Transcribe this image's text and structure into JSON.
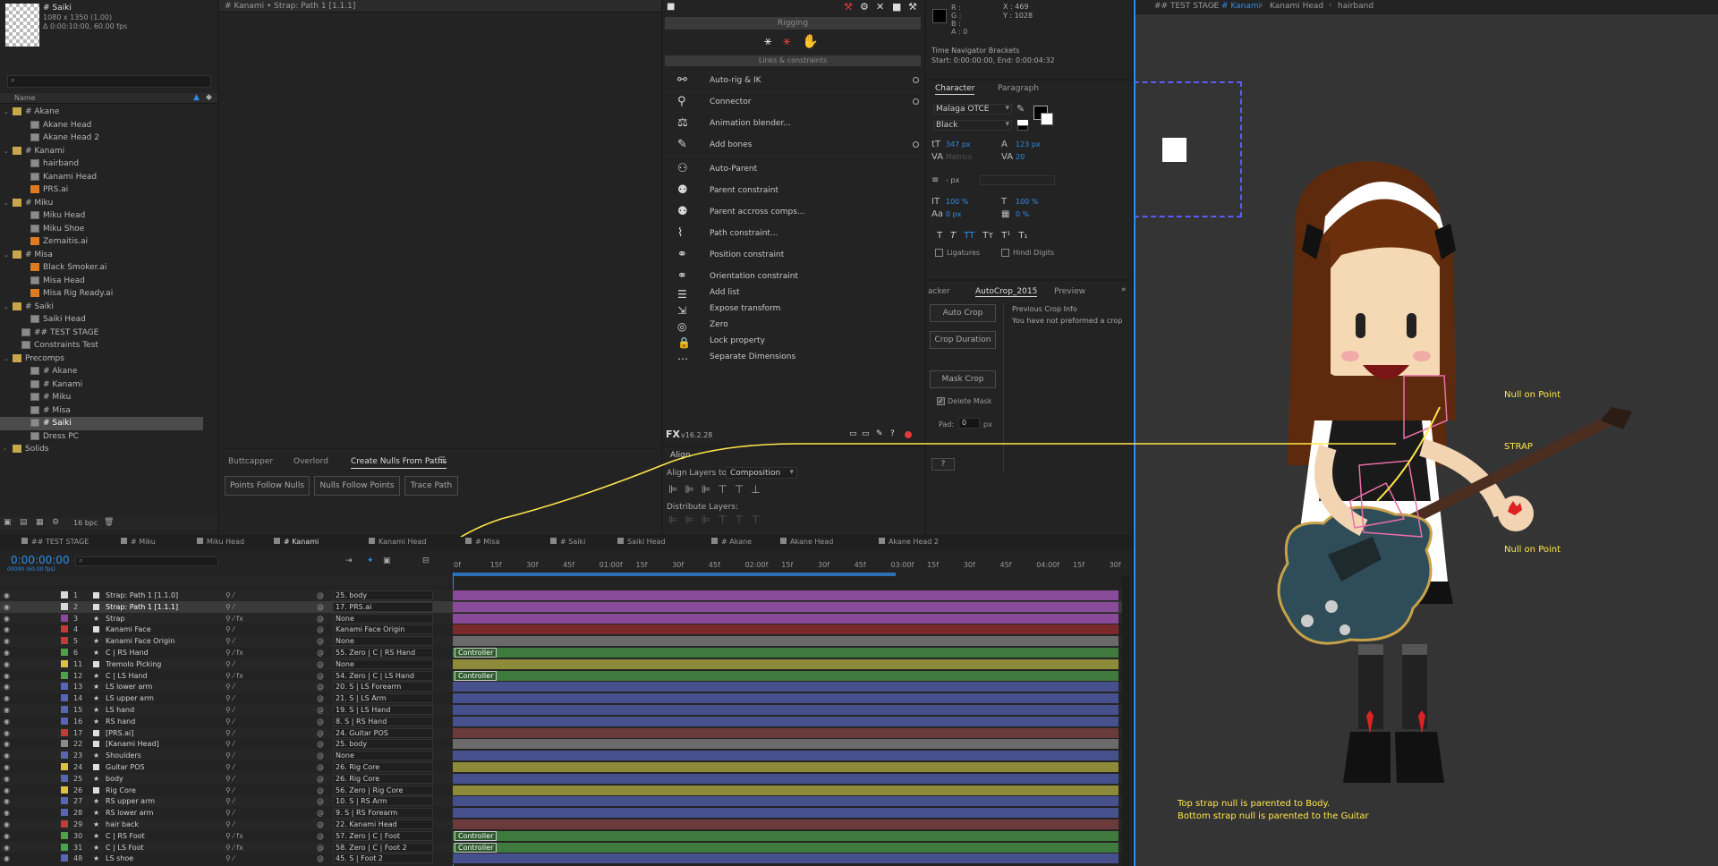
{
  "project": {
    "comp_name": "# Saiki",
    "comp_info_1": "1080 x 1350 (1.00)",
    "comp_info_2": "Δ 0:00:10:00, 60.00 fps",
    "search_placeholder": "",
    "name_col": "Name",
    "tree": [
      {
        "label": "# Akane",
        "type": "folder",
        "indent": 0
      },
      {
        "label": "Akane Head",
        "type": "comp",
        "indent": 2
      },
      {
        "label": "Akane Head 2",
        "type": "comp",
        "indent": 2
      },
      {
        "label": "# Kanami",
        "type": "folder",
        "indent": 0
      },
      {
        "label": "hairband",
        "type": "comp",
        "indent": 2
      },
      {
        "label": "Kanami Head",
        "type": "comp",
        "indent": 2
      },
      {
        "label": "PRS.ai",
        "type": "ai",
        "indent": 2
      },
      {
        "label": "# Miku",
        "type": "folder",
        "indent": 0
      },
      {
        "label": "Miku Head",
        "type": "comp",
        "indent": 2
      },
      {
        "label": "Miku Shoe",
        "type": "comp",
        "indent": 2
      },
      {
        "label": "Zemaitis.ai",
        "type": "ai",
        "indent": 2
      },
      {
        "label": "# Misa",
        "type": "folder",
        "indent": 0
      },
      {
        "label": "Black Smoker.ai",
        "type": "ai",
        "indent": 2
      },
      {
        "label": "Misa Head",
        "type": "comp",
        "indent": 2
      },
      {
        "label": "Misa Rig Ready.ai",
        "type": "ai",
        "indent": 2
      },
      {
        "label": "# Saiki",
        "type": "folder",
        "indent": 0
      },
      {
        "label": "Saiki Head",
        "type": "comp",
        "indent": 2
      },
      {
        "label": "## TEST STAGE",
        "type": "comp",
        "indent": 1
      },
      {
        "label": "Constraints Test",
        "type": "comp",
        "indent": 1
      },
      {
        "label": "Precomps",
        "type": "folder",
        "indent": 0
      },
      {
        "label": "# Akane",
        "type": "comp",
        "indent": 2
      },
      {
        "label": "# Kanami",
        "type": "comp",
        "indent": 2
      },
      {
        "label": "# Miku",
        "type": "comp",
        "indent": 2
      },
      {
        "label": "# Misa",
        "type": "comp",
        "indent": 2
      },
      {
        "label": "# Saiki",
        "type": "comp",
        "indent": 2,
        "selected": true
      },
      {
        "label": "Dress PC",
        "type": "comp",
        "indent": 2
      },
      {
        "label": "Solids",
        "type": "folder",
        "indent": 0
      }
    ],
    "bpc": "16 bpc"
  },
  "layer_panel_title": "# Kanami • Strap: Path 1 [1.1.1]",
  "nulls_panel": {
    "tabs": [
      "Buttcapper",
      "Overlord",
      "Create Nulls From Paths"
    ],
    "buttons": [
      "Points Follow Nulls",
      "Nulls Follow Points",
      "Trace Path"
    ]
  },
  "rigging": {
    "title": "Rigging",
    "section": "Links & constraints",
    "items": [
      {
        "label": "Auto-rig & IK",
        "icon": "bone-icon",
        "dot": true
      },
      {
        "label": "Connector",
        "icon": "connector-icon",
        "dot": true
      },
      {
        "label": "Animation blender...",
        "icon": "blender-icon",
        "dot": false
      },
      {
        "label": "Add bones",
        "icon": "pin-icon",
        "dot": true
      },
      {
        "label": "Auto-Parent",
        "icon": "auto-parent-icon",
        "dot": false
      },
      {
        "label": "Parent constraint",
        "icon": "parent-icon",
        "dot": false
      },
      {
        "label": "Parent accross comps...",
        "icon": "parent-comps-icon",
        "dot": false
      },
      {
        "label": "Path constraint...",
        "icon": "path-icon",
        "dot": false
      },
      {
        "label": "Position constraint",
        "icon": "position-icon",
        "dot": false
      },
      {
        "label": "Orientation constraint",
        "icon": "orientation-icon",
        "dot": false
      }
    ],
    "small_items": [
      {
        "label": "Add list",
        "icon": "list-icon"
      },
      {
        "label": "Expose transform",
        "icon": "expose-icon"
      },
      {
        "label": "Zero",
        "icon": "zero-icon"
      },
      {
        "label": "Lock property",
        "icon": "lock-icon"
      },
      {
        "label": "Separate Dimensions",
        "icon": "separate-icon"
      }
    ],
    "version": "v16.2.28"
  },
  "align": {
    "tab": "Align",
    "align_to_label": "Align Layers to:",
    "align_to_value": "Composition",
    "distribute_label": "Distribute Layers:"
  },
  "info": {
    "r": "R :",
    "g": "G :",
    "b": "B :",
    "a": "A : 0",
    "x": "X : 469",
    "y": "Y : 1028",
    "nav_title": "Time Navigator Brackets",
    "nav_value": "Start: 0:00:00:00, End: 0:00:04:32"
  },
  "character": {
    "tabs": [
      "Character",
      "Paragraph"
    ],
    "font": "Malaga OTCE",
    "style": "Black",
    "size": "347 px",
    "leading": "123 px",
    "kerning": "Metrics",
    "tracking": "20",
    "indent": "- px",
    "vscale": "100 %",
    "hscale": "100 %",
    "baseline": "0 px",
    "tsume": "0 %",
    "ligatures": "Ligatures",
    "hindi": "Hindi Digits",
    "style_buttons": [
      "T",
      "T",
      "TT",
      "Tт",
      "T¹",
      "T₁"
    ]
  },
  "autocrop": {
    "tabs": [
      "acker",
      "AutoCrop_2015",
      "Preview"
    ],
    "auto_crop": "Auto Crop",
    "crop_duration": "Crop Duration",
    "mask_crop": "Mask Crop",
    "delete_mask": "Delete Mask",
    "pad_label": "Pad:",
    "pad_value": "0",
    "pad_unit": "px",
    "info_title": "Previous Crop Info",
    "info_text": "You have not preformed a crop",
    "help": "?"
  },
  "viewer": {
    "breadcrumbs": [
      "## TEST STAGE",
      "# Kanami",
      "Kanami Head",
      "hairband"
    ],
    "annotations": {
      "null_top": "Null on Point",
      "strap": "STRAP",
      "null_bottom": "Null on Point",
      "caption1": "Top strap null is parented to Body.",
      "caption2": "Bottom strap null is parented to the Guitar"
    }
  },
  "timeline": {
    "tabs": [
      "## TEST STAGE",
      "# Miku",
      "Miku Head",
      "# Kanami",
      "Kanami Head",
      "# Misa",
      "# Saiki",
      "Saiki Head",
      "# Akane",
      "Akane Head",
      "Akane Head 2"
    ],
    "active_tab": "# Kanami",
    "timecode": "0:00:00:00",
    "fps": "00000 (60.00 fps)",
    "ruler": [
      "0f",
      "15f",
      "30f",
      "45f",
      "01:00f",
      "15f",
      "30f",
      "45f",
      "02:00f",
      "15f",
      "30f",
      "45f",
      "03:00f",
      "15f",
      "30f",
      "45f",
      "04:00f",
      "15f",
      "30f"
    ],
    "controller": "Controller",
    "layers": [
      {
        "num": "1",
        "name": "Strap: Path 1 [1.1.0]",
        "parent": "25. body",
        "color": "#d9d9d9",
        "bar": "#8a4a9a",
        "star": false,
        "fx": false,
        "sel": true
      },
      {
        "num": "2",
        "name": "Strap: Path 1 [1.1.1]",
        "parent": "17. PRS.ai",
        "color": "#d9d9d9",
        "bar": "#8a4a9a",
        "star": false,
        "fx": false,
        "sel": true,
        "hl": true
      },
      {
        "num": "3",
        "name": "Strap",
        "parent": "None",
        "color": "#8a4a9a",
        "bar": "#8a4a9a",
        "star": true,
        "fx": true
      },
      {
        "num": "4",
        "name": "Kanami Face",
        "parent": "Kanami Face Origin",
        "color": "#c23b3b",
        "bar": "#7a2a2a",
        "star": false,
        "fx": false
      },
      {
        "num": "5",
        "name": "Kanami Face Origin",
        "parent": "None",
        "color": "#c23b3b",
        "bar": "#6a6a6a",
        "star": true,
        "fx": false
      },
      {
        "num": "6",
        "name": "C | RS Hand",
        "parent": "55. Zero | C | RS Hand",
        "color": "#4aa34a",
        "bar": "#3f7a3f",
        "star": true,
        "fx": true,
        "ctrl": true
      },
      {
        "num": "11",
        "name": "Tremolo Picking",
        "parent": "None",
        "color": "#d9c33b",
        "bar": "#8d8a3a",
        "star": false,
        "fx": false
      },
      {
        "num": "12",
        "name": "C | LS Hand",
        "parent": "54. Zero | C | LS Hand",
        "color": "#4aa34a",
        "bar": "#3f7a3f",
        "star": true,
        "fx": true,
        "ctrl": true
      },
      {
        "num": "13",
        "name": "LS lower arm",
        "parent": "20. S | LS Forearm",
        "color": "#5865b5",
        "bar": "#46508c",
        "star": true,
        "fx": false
      },
      {
        "num": "14",
        "name": "LS upper arm",
        "parent": "21. S | LS Arm",
        "color": "#5865b5",
        "bar": "#46508c",
        "star": true,
        "fx": false
      },
      {
        "num": "15",
        "name": "LS hand",
        "parent": "19. S | LS Hand",
        "color": "#5865b5",
        "bar": "#46508c",
        "star": true,
        "fx": false
      },
      {
        "num": "16",
        "name": "RS hand",
        "parent": "8. S | RS Hand",
        "color": "#5865b5",
        "bar": "#46508c",
        "star": true,
        "fx": false
      },
      {
        "num": "17",
        "name": "[PRS.ai]",
        "parent": "24. Guitar POS",
        "color": "#c23b3b",
        "bar": "#6b3b3b",
        "star": false,
        "fx": false
      },
      {
        "num": "22",
        "name": "[Kanami Head]",
        "parent": "25. body",
        "color": "#8b8b8b",
        "bar": "#6b6b6b",
        "star": false,
        "fx": false
      },
      {
        "num": "23",
        "name": "Shoulders",
        "parent": "None",
        "color": "#5865b5",
        "bar": "#46508c",
        "star": true,
        "fx": false
      },
      {
        "num": "24",
        "name": "Guitar POS",
        "parent": "26. Rig Core",
        "color": "#d9c33b",
        "bar": "#8d8a3a",
        "star": false,
        "fx": false
      },
      {
        "num": "25",
        "name": "body",
        "parent": "26. Rig Core",
        "color": "#5865b5",
        "bar": "#46508c",
        "star": true,
        "fx": false
      },
      {
        "num": "26",
        "name": "Rig Core",
        "parent": "56. Zero | Rig Core",
        "color": "#d9c33b",
        "bar": "#8d8a3a",
        "star": false,
        "fx": false
      },
      {
        "num": "27",
        "name": "RS upper arm",
        "parent": "10. S | RS Arm",
        "color": "#5865b5",
        "bar": "#46508c",
        "star": true,
        "fx": false
      },
      {
        "num": "28",
        "name": "RS lower arm",
        "parent": "9. S | RS Forearm",
        "color": "#5865b5",
        "bar": "#46508c",
        "star": true,
        "fx": false
      },
      {
        "num": "29",
        "name": "hair back",
        "parent": "22. Kanami Head",
        "color": "#c23b3b",
        "bar": "#6b3b3b",
        "star": true,
        "fx": false
      },
      {
        "num": "30",
        "name": "C | RS Foot",
        "parent": "57. Zero | C | Foot",
        "color": "#4aa34a",
        "bar": "#3f7a3f",
        "star": true,
        "fx": true,
        "ctrl": true
      },
      {
        "num": "31",
        "name": "C | LS Foot",
        "parent": "58. Zero | C | Foot 2",
        "color": "#4aa34a",
        "bar": "#3f7a3f",
        "star": true,
        "fx": true,
        "ctrl": true
      },
      {
        "num": "48",
        "name": "LS shoe",
        "parent": "45. S | Foot 2",
        "color": "#5865b5",
        "bar": "#46508c",
        "star": true,
        "fx": false
      }
    ]
  },
  "colors": {
    "accent": "#2d8ceb",
    "annotation": "#ffe74a",
    "selection_box": "#5b5bff"
  }
}
